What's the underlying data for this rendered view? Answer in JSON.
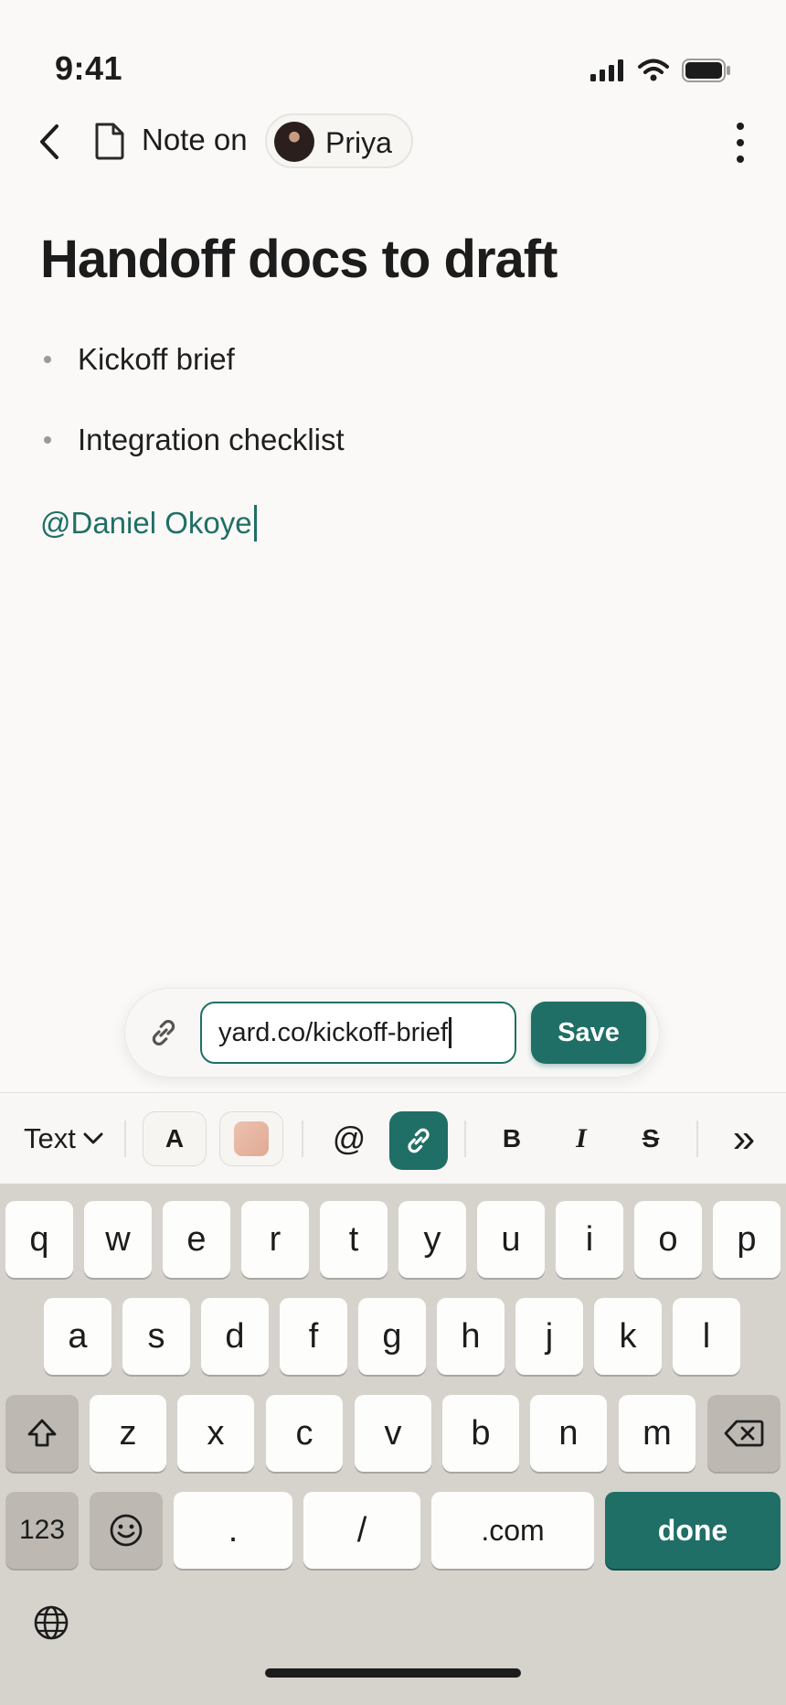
{
  "status_bar": {
    "time": "9:41"
  },
  "header": {
    "note_on_label": "Note on",
    "person_name": "Priya"
  },
  "note": {
    "title": "Handoff docs to draft",
    "bullets": [
      "Kickoff brief",
      "Integration checklist"
    ],
    "mention": "@Daniel Okoye"
  },
  "link_popover": {
    "url_value": "yard.co/kickoff-brief",
    "save_label": "Save"
  },
  "toolbar": {
    "text_style": "Text",
    "color_label": "A",
    "mention_symbol": "@",
    "bold": "B",
    "italic": "I",
    "strike": "S",
    "more": "»"
  },
  "keyboard": {
    "row1": [
      "q",
      "w",
      "e",
      "r",
      "t",
      "y",
      "u",
      "i",
      "o",
      "p"
    ],
    "row2": [
      "a",
      "s",
      "d",
      "f",
      "g",
      "h",
      "j",
      "k",
      "l"
    ],
    "row3": [
      "z",
      "x",
      "c",
      "v",
      "b",
      "n",
      "m"
    ],
    "numbers_label": "123",
    "dot_label": ".",
    "slash_label": "/",
    "dotcom_label": ".com",
    "done_label": "done"
  },
  "colors": {
    "accent": "#1f6f66",
    "background": "#faf9f7",
    "highlight_swatch": "#e8b9a5"
  }
}
